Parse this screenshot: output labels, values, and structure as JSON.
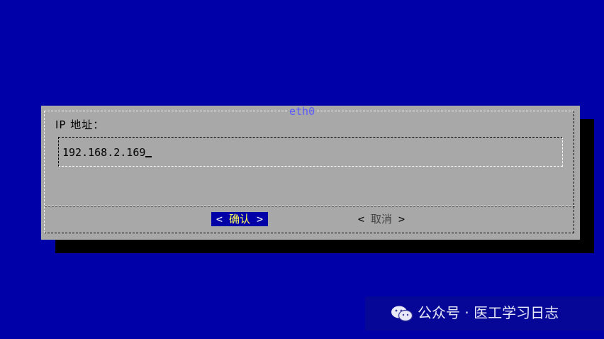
{
  "dialog": {
    "title": "eth0",
    "prompt": "IP 地址：",
    "input_value": "192.168.2.169"
  },
  "buttons": {
    "ok": {
      "open": "<",
      "label": "确认",
      "close": ">"
    },
    "cancel": {
      "open": "<",
      "label": "取消",
      "close": ">"
    }
  },
  "watermark": {
    "text": "公众号 · 医工学习日志",
    "icon": "wechat-icon"
  },
  "colors": {
    "background": "#0000a8",
    "dialog": "#a8a8a8",
    "title": "#5a5aff",
    "selected_button_bg": "#0000a8",
    "selected_button_fg": "#ffff55"
  }
}
